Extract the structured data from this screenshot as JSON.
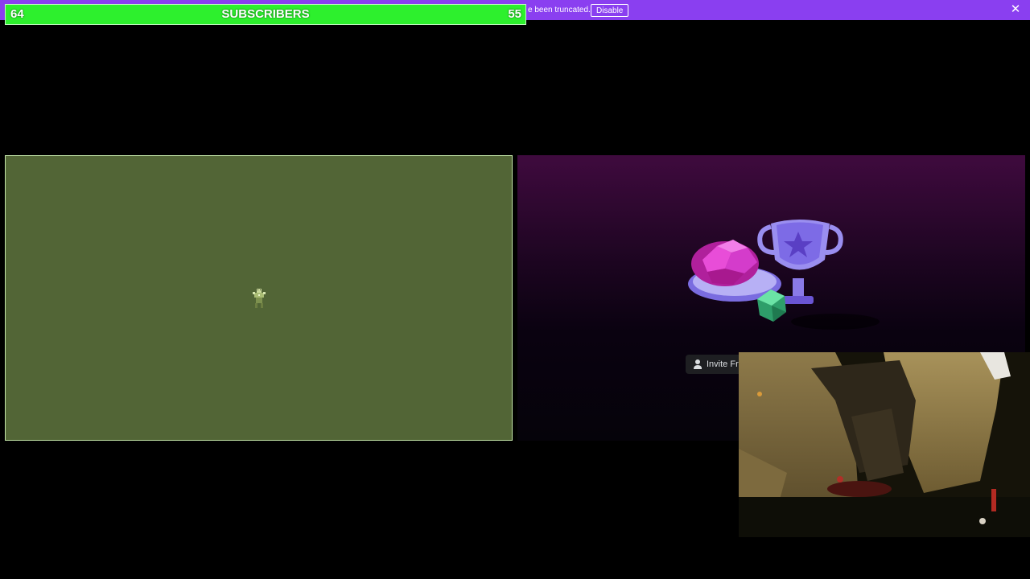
{
  "notice": {
    "text": "e been truncated.",
    "disable_label": "Disable",
    "close_glyph": "✕",
    "bg_color": "#8a3ff0"
  },
  "subscriber_bar": {
    "left_value": "64",
    "title": "SUBSCRIBERS",
    "right_value": "55",
    "bar_color": "#2df02d"
  },
  "game_panel": {
    "bg_color": "#526536",
    "sprite_icon": "pixel-character-icon"
  },
  "activity_panel": {
    "art_icon": "activity-trophy-illustration-icon"
  },
  "invite": {
    "label": "Invite Fri",
    "icon": "add-user-icon"
  },
  "webcam": {
    "label_icon": "webcam-feed"
  }
}
